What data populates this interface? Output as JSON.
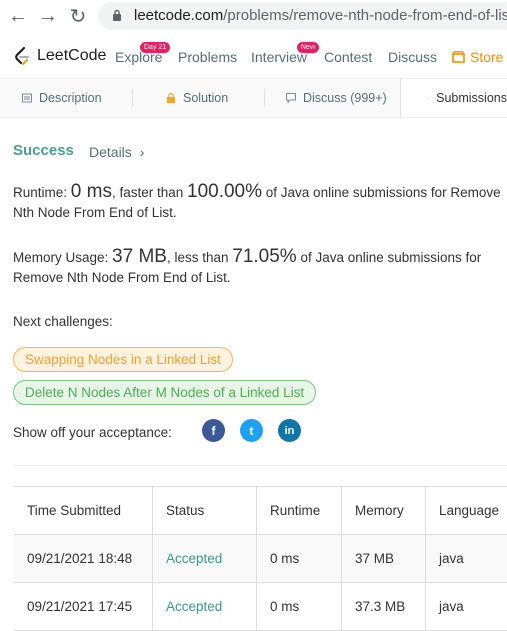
{
  "browser": {
    "url_host": "leetcode.com",
    "url_path": "/problems/remove-nth-node-from-end-of-list/"
  },
  "topnav": {
    "logo": "LeetCode",
    "items": [
      {
        "label": "Explore",
        "badge": "Day 21"
      },
      {
        "label": "Problems"
      },
      {
        "label": "Interview",
        "badge": "New"
      },
      {
        "label": "Contest"
      },
      {
        "label": "Discuss"
      },
      {
        "label": "Store"
      }
    ]
  },
  "tabs": [
    {
      "label": "Description",
      "icon": "description-icon"
    },
    {
      "label": "Solution",
      "icon": "lock-icon"
    },
    {
      "label": "Discuss (999+)",
      "icon": "discuss-icon"
    },
    {
      "label": "Submissions",
      "icon": "clock-icon"
    }
  ],
  "result": {
    "status": "Success",
    "details": "Details",
    "runtime_label": "Runtime: ",
    "runtime_value": "0 ms",
    "runtime_mid": ", faster than ",
    "runtime_pct": "100.00%",
    "runtime_tail": " of Java online submissions for Remove Nth Node From End of List.",
    "memory_label": "Memory Usage: ",
    "memory_value": "37 MB",
    "memory_mid": ", less than ",
    "memory_pct": "71.05%",
    "memory_tail": " of Java online submissions for Remove Nth Node From End of List.",
    "next_challenges_label": "Next challenges:",
    "challenges": [
      "Swapping Nodes in a Linked List",
      "Delete N Nodes After M Nodes of a Linked List"
    ],
    "show_off_label": "Show off your acceptance:",
    "social": {
      "facebook": "f",
      "twitter": "t",
      "linkedin": "in"
    }
  },
  "colors": {
    "accent": "#4a9e8f",
    "orange": "#f4a02d",
    "green": "#4caf50",
    "facebook": "#3b5998",
    "twitter": "#1da1f2",
    "linkedin": "#0e76a8"
  },
  "table": {
    "headers": [
      "Time Submitted",
      "Status",
      "Runtime",
      "Memory",
      "Language"
    ],
    "rows": [
      [
        "09/21/2021 18:48",
        "Accepted",
        "0 ms",
        "37 MB",
        "java"
      ],
      [
        "09/21/2021 17:45",
        "Accepted",
        "0 ms",
        "37.3 MB",
        "java"
      ]
    ]
  }
}
